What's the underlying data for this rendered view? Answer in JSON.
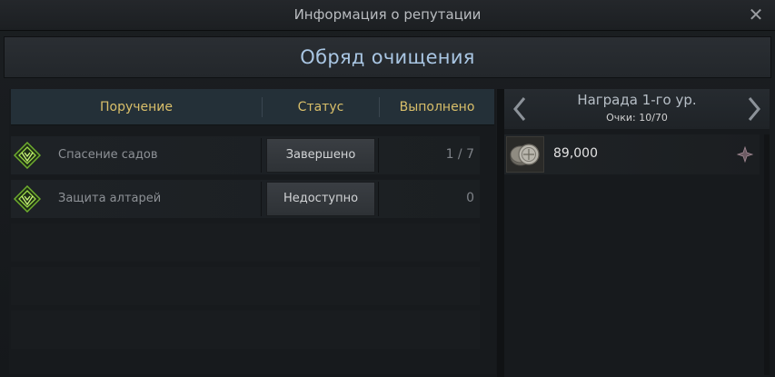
{
  "window": {
    "title": "Информация о репутации",
    "close_icon": "close-icon"
  },
  "header": {
    "title": "Обряд очищения"
  },
  "table": {
    "columns": [
      "Поручение",
      "Статус",
      "Выполнено"
    ],
    "rows": [
      {
        "icon": "guild-emblem-icon",
        "task": "Спасение садов",
        "status": "Завершено",
        "progress": "1 / 7"
      },
      {
        "icon": "guild-emblem-icon",
        "task": "Защита алтарей",
        "status": "Недоступно",
        "progress": "0"
      }
    ]
  },
  "reward": {
    "title": "Награда 1-го ур.",
    "points": "Очки: 10/70",
    "items": [
      {
        "icon": "silver-coin-icon",
        "amount": "89,000"
      }
    ]
  },
  "colors": {
    "accent_gold": "#d9bf6a",
    "header_blue": "#a9c6e3",
    "emblem_green": "#8fcf3a"
  }
}
